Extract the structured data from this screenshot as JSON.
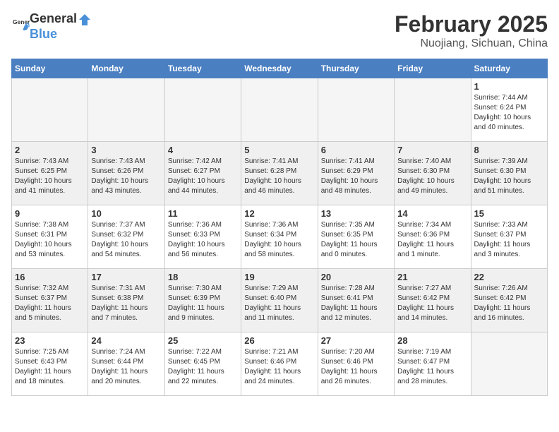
{
  "header": {
    "logo_general": "General",
    "logo_blue": "Blue",
    "month_year": "February 2025",
    "location": "Nuojiang, Sichuan, China"
  },
  "weekdays": [
    "Sunday",
    "Monday",
    "Tuesday",
    "Wednesday",
    "Thursday",
    "Friday",
    "Saturday"
  ],
  "weeks": [
    [
      {
        "day": "",
        "info": ""
      },
      {
        "day": "",
        "info": ""
      },
      {
        "day": "",
        "info": ""
      },
      {
        "day": "",
        "info": ""
      },
      {
        "day": "",
        "info": ""
      },
      {
        "day": "",
        "info": ""
      },
      {
        "day": "1",
        "info": "Sunrise: 7:44 AM\nSunset: 6:24 PM\nDaylight: 10 hours\nand 40 minutes."
      }
    ],
    [
      {
        "day": "2",
        "info": "Sunrise: 7:43 AM\nSunset: 6:25 PM\nDaylight: 10 hours\nand 41 minutes."
      },
      {
        "day": "3",
        "info": "Sunrise: 7:43 AM\nSunset: 6:26 PM\nDaylight: 10 hours\nand 43 minutes."
      },
      {
        "day": "4",
        "info": "Sunrise: 7:42 AM\nSunset: 6:27 PM\nDaylight: 10 hours\nand 44 minutes."
      },
      {
        "day": "5",
        "info": "Sunrise: 7:41 AM\nSunset: 6:28 PM\nDaylight: 10 hours\nand 46 minutes."
      },
      {
        "day": "6",
        "info": "Sunrise: 7:41 AM\nSunset: 6:29 PM\nDaylight: 10 hours\nand 48 minutes."
      },
      {
        "day": "7",
        "info": "Sunrise: 7:40 AM\nSunset: 6:30 PM\nDaylight: 10 hours\nand 49 minutes."
      },
      {
        "day": "8",
        "info": "Sunrise: 7:39 AM\nSunset: 6:30 PM\nDaylight: 10 hours\nand 51 minutes."
      }
    ],
    [
      {
        "day": "9",
        "info": "Sunrise: 7:38 AM\nSunset: 6:31 PM\nDaylight: 10 hours\nand 53 minutes."
      },
      {
        "day": "10",
        "info": "Sunrise: 7:37 AM\nSunset: 6:32 PM\nDaylight: 10 hours\nand 54 minutes."
      },
      {
        "day": "11",
        "info": "Sunrise: 7:36 AM\nSunset: 6:33 PM\nDaylight: 10 hours\nand 56 minutes."
      },
      {
        "day": "12",
        "info": "Sunrise: 7:36 AM\nSunset: 6:34 PM\nDaylight: 10 hours\nand 58 minutes."
      },
      {
        "day": "13",
        "info": "Sunrise: 7:35 AM\nSunset: 6:35 PM\nDaylight: 11 hours\nand 0 minutes."
      },
      {
        "day": "14",
        "info": "Sunrise: 7:34 AM\nSunset: 6:36 PM\nDaylight: 11 hours\nand 1 minute."
      },
      {
        "day": "15",
        "info": "Sunrise: 7:33 AM\nSunset: 6:37 PM\nDaylight: 11 hours\nand 3 minutes."
      }
    ],
    [
      {
        "day": "16",
        "info": "Sunrise: 7:32 AM\nSunset: 6:37 PM\nDaylight: 11 hours\nand 5 minutes."
      },
      {
        "day": "17",
        "info": "Sunrise: 7:31 AM\nSunset: 6:38 PM\nDaylight: 11 hours\nand 7 minutes."
      },
      {
        "day": "18",
        "info": "Sunrise: 7:30 AM\nSunset: 6:39 PM\nDaylight: 11 hours\nand 9 minutes."
      },
      {
        "day": "19",
        "info": "Sunrise: 7:29 AM\nSunset: 6:40 PM\nDaylight: 11 hours\nand 11 minutes."
      },
      {
        "day": "20",
        "info": "Sunrise: 7:28 AM\nSunset: 6:41 PM\nDaylight: 11 hours\nand 12 minutes."
      },
      {
        "day": "21",
        "info": "Sunrise: 7:27 AM\nSunset: 6:42 PM\nDaylight: 11 hours\nand 14 minutes."
      },
      {
        "day": "22",
        "info": "Sunrise: 7:26 AM\nSunset: 6:42 PM\nDaylight: 11 hours\nand 16 minutes."
      }
    ],
    [
      {
        "day": "23",
        "info": "Sunrise: 7:25 AM\nSunset: 6:43 PM\nDaylight: 11 hours\nand 18 minutes."
      },
      {
        "day": "24",
        "info": "Sunrise: 7:24 AM\nSunset: 6:44 PM\nDaylight: 11 hours\nand 20 minutes."
      },
      {
        "day": "25",
        "info": "Sunrise: 7:22 AM\nSunset: 6:45 PM\nDaylight: 11 hours\nand 22 minutes."
      },
      {
        "day": "26",
        "info": "Sunrise: 7:21 AM\nSunset: 6:46 PM\nDaylight: 11 hours\nand 24 minutes."
      },
      {
        "day": "27",
        "info": "Sunrise: 7:20 AM\nSunset: 6:46 PM\nDaylight: 11 hours\nand 26 minutes."
      },
      {
        "day": "28",
        "info": "Sunrise: 7:19 AM\nSunset: 6:47 PM\nDaylight: 11 hours\nand 28 minutes."
      },
      {
        "day": "",
        "info": ""
      }
    ]
  ]
}
